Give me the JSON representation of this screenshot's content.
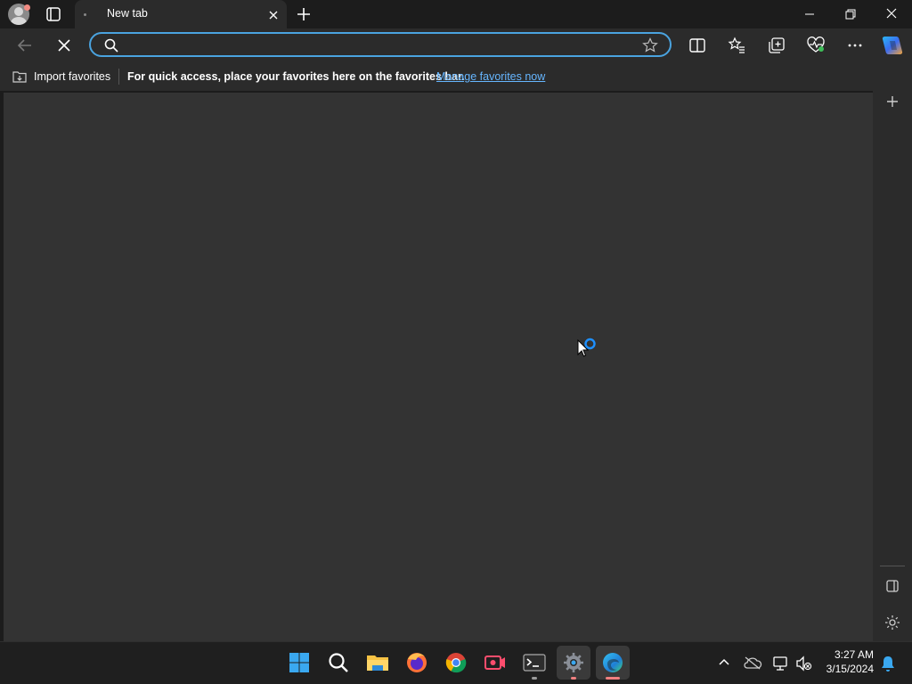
{
  "browser": {
    "tab": {
      "title": "New tab"
    },
    "address_bar": {
      "value": "",
      "placeholder": ""
    },
    "favorites_bar": {
      "import_label": "Import favorites",
      "message": "For quick access, place your favorites here on the favorites bar.",
      "manage_link": "Manage favorites now"
    }
  },
  "icons": {
    "profile": "profile-avatar-icon",
    "tab_actions": "tab-actions-icon",
    "new_tab": "plus-icon",
    "back": "arrow-left-icon",
    "stop": "close-icon",
    "search": "search-icon",
    "favorite": "star-icon",
    "split_screen": "split-screen-icon",
    "favorites": "favorites-icon",
    "collections": "collections-icon",
    "browser_essentials": "heartbeat-icon",
    "more": "ellipsis-icon",
    "copilot": "copilot-icon"
  },
  "taskbar": {
    "apps": [
      "Start",
      "Search",
      "File Explorer",
      "Firefox",
      "Chrome",
      "Screen Recorder",
      "Terminal",
      "Settings",
      "Microsoft Edge"
    ],
    "clock": {
      "time": "3:27 AM",
      "date": "3/15/2024"
    }
  },
  "colors": {
    "accent": "#4aa3df",
    "link": "#66b6ff",
    "content_bg": "#333333",
    "chrome_bg": "#2b2b2b",
    "titlebar_bg": "#1c1c1c"
  }
}
